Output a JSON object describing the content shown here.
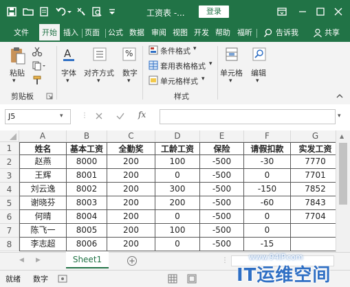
{
  "window": {
    "title": "工资表 -...",
    "login_label": "登录"
  },
  "tabs": [
    "文件",
    "开始",
    "插入",
    "页面",
    "公式",
    "数据",
    "审阅",
    "视图",
    "开发",
    "帮助",
    "福昕",
    "告诉我",
    "共享"
  ],
  "ribbon": {
    "paste": "粘贴",
    "font": "字体",
    "align": "对齐方式",
    "number": "数字",
    "percent": "%",
    "cond_format": "条件格式",
    "table_format": "套用表格格式",
    "cell_style": "单元格样式",
    "cells": "单元格",
    "edit": "编辑",
    "group_clipboard": "剪贴板",
    "group_styles": "样式"
  },
  "formula_bar": {
    "name_box": "J5",
    "fx": "fx",
    "formula": ""
  },
  "columns": [
    "A",
    "B",
    "C",
    "D",
    "E",
    "F",
    "G"
  ],
  "rows": [
    "1",
    "2",
    "3",
    "4",
    "5",
    "6",
    "7",
    "8"
  ],
  "table": {
    "headers": [
      "姓名",
      "基本工资",
      "全勤奖",
      "工龄工资",
      "保险",
      "请假扣款",
      "实发工资"
    ],
    "rows": [
      [
        "赵燕",
        "8000",
        "200",
        "100",
        "-500",
        "-30",
        "7770"
      ],
      [
        "王辉",
        "8001",
        "200",
        "0",
        "-500",
        "0",
        "7701"
      ],
      [
        "刘云逸",
        "8002",
        "200",
        "300",
        "-500",
        "-150",
        "7852"
      ],
      [
        "谢晓芬",
        "8003",
        "200",
        "200",
        "-500",
        "-60",
        "7843"
      ],
      [
        "何晴",
        "8004",
        "200",
        "0",
        "-500",
        "0",
        "7704"
      ],
      [
        "陈飞一",
        "8005",
        "200",
        "100",
        "-500",
        "0",
        ""
      ],
      [
        "李志超",
        "8006",
        "200",
        "0",
        "-500",
        "-15",
        ""
      ]
    ]
  },
  "sheet": {
    "name": "Sheet1"
  },
  "status": {
    "ready": "就绪",
    "mode": "数字"
  },
  "watermark": {
    "url": "www.94IP.com",
    "brand": "IT运维空间"
  }
}
